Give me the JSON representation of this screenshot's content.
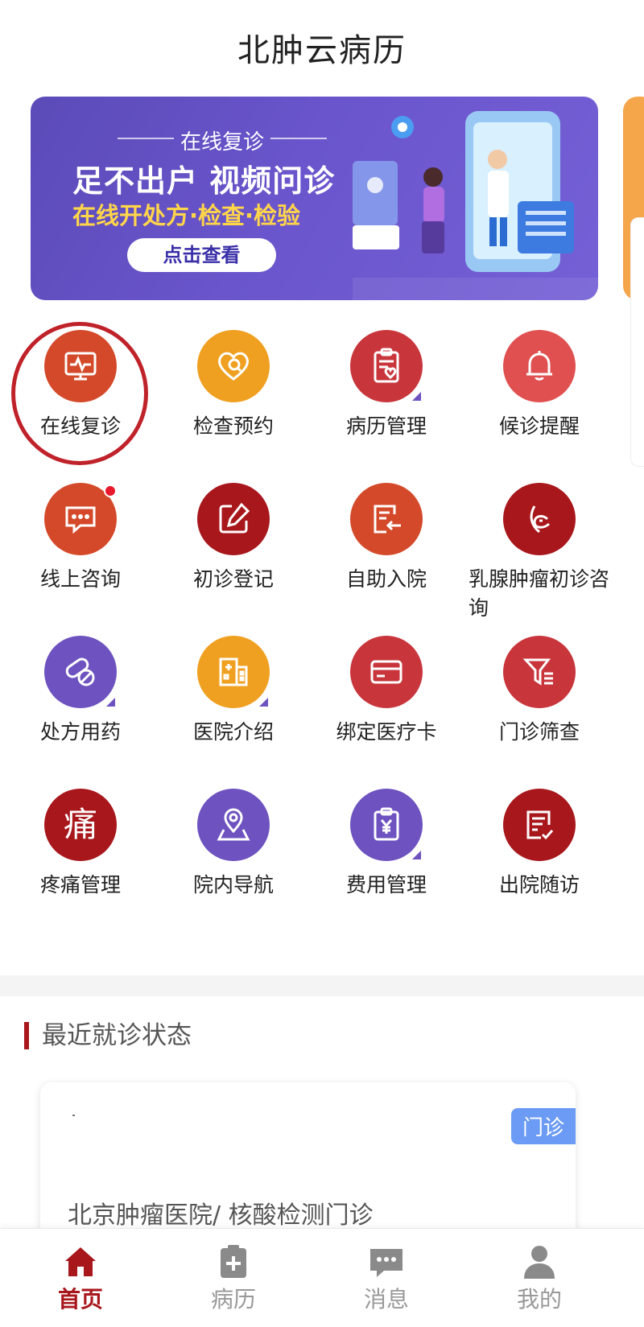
{
  "app": {
    "title": "北肿云病历"
  },
  "banner": {
    "subtitle": "在线复诊",
    "headline": "足不出户 视频问诊",
    "tagline": "在线开处方·检查·检验",
    "button_label": "点击查看"
  },
  "services": [
    {
      "label": "在线复诊",
      "icon": "monitor-heartbeat-icon",
      "color": "#d4492a"
    },
    {
      "label": "检查预约",
      "icon": "heart-search-icon",
      "color": "#f0a020"
    },
    {
      "label": "病历管理",
      "icon": "clipboard-heart-icon",
      "color": "#c8363c"
    },
    {
      "label": "候诊提醒",
      "icon": "bell-icon",
      "color": "#e05050"
    },
    {
      "label": "线上咨询",
      "icon": "chat-bubble-icon",
      "color": "#d4492a",
      "has_notification": true
    },
    {
      "label": "初诊登记",
      "icon": "edit-square-icon",
      "color": "#a8171c"
    },
    {
      "label": "自助入院",
      "icon": "document-arrow-icon",
      "color": "#d4492a"
    },
    {
      "label": "乳腺肿瘤初诊咨询",
      "icon": "ribbon-icon",
      "color": "#a8171c"
    },
    {
      "label": "处方用药",
      "icon": "pills-icon",
      "color": "#6d52c0"
    },
    {
      "label": "医院介绍",
      "icon": "hospital-building-icon",
      "color": "#f0a020"
    },
    {
      "label": "绑定医疗卡",
      "icon": "card-icon",
      "color": "#c8363c"
    },
    {
      "label": "门诊筛查",
      "icon": "filter-icon",
      "color": "#c8363c"
    },
    {
      "label": "疼痛管理",
      "icon": "pain-character-icon",
      "color": "#a8171c",
      "glyph": "痛"
    },
    {
      "label": "院内导航",
      "icon": "map-pin-icon",
      "color": "#6d52c0"
    },
    {
      "label": "费用管理",
      "icon": "yen-clipboard-icon",
      "color": "#6d52c0"
    },
    {
      "label": "出院随访",
      "icon": "document-check-icon",
      "color": "#a8171c"
    }
  ],
  "recent": {
    "section_title": "最近就诊状态",
    "card": {
      "tag": "门诊",
      "text": "北京肿瘤医院/ 核酸检测门诊"
    }
  },
  "nav": [
    {
      "label": "首页",
      "icon": "home-icon",
      "active": true
    },
    {
      "label": "病历",
      "icon": "clipboard-plus-icon",
      "active": false
    },
    {
      "label": "消息",
      "icon": "message-icon",
      "active": false
    },
    {
      "label": "我的",
      "icon": "user-icon",
      "active": false
    }
  ],
  "colors": {
    "brand": "#a8171c",
    "banner": "#6a55cc",
    "accent_yellow": "#ffd54a"
  }
}
